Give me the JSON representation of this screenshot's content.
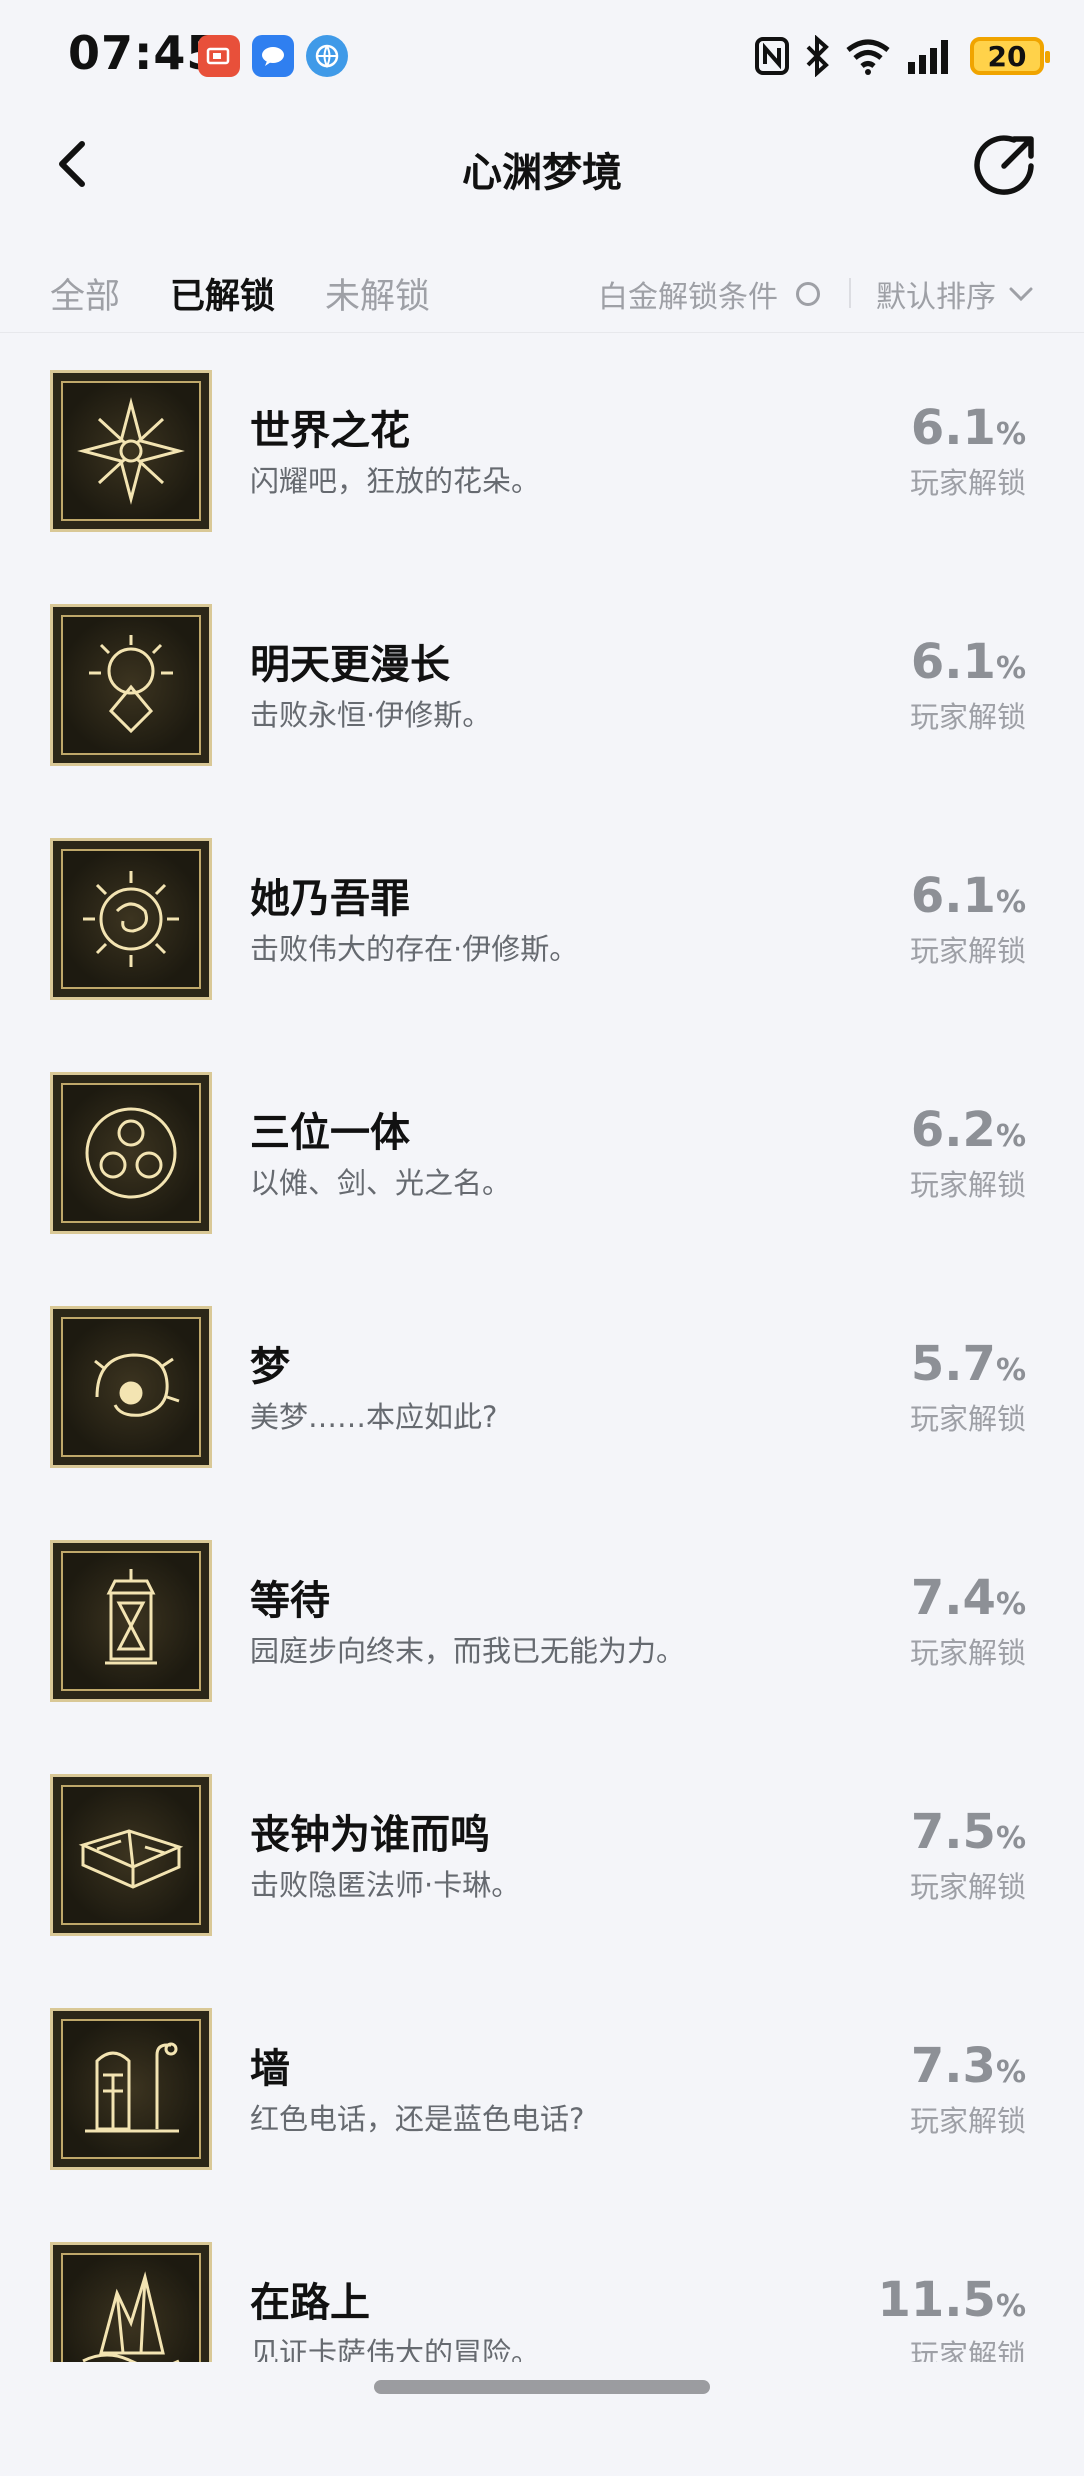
{
  "status_bar": {
    "time": "07:45",
    "battery": "20",
    "icons": [
      "app-red-icon",
      "chat-bubble-icon",
      "compass-icon",
      "nfc-icon",
      "bluetooth-icon",
      "wifi-icon",
      "signal-icon",
      "battery-icon"
    ]
  },
  "header": {
    "title": "心渊梦境",
    "back_icon": "chevron-left-icon",
    "share_icon": "share-icon"
  },
  "filters": {
    "tabs": [
      {
        "label": "全部",
        "active": false
      },
      {
        "label": "已解锁",
        "active": true
      },
      {
        "label": "未解锁",
        "active": false
      }
    ],
    "condition_label": "白金解锁条件",
    "sort_label": "默认排序"
  },
  "achievements": [
    {
      "title": "世界之花",
      "desc": "闪耀吧，狂放的花朵。",
      "pct": "6.1",
      "sign": "%",
      "label": "玩家解锁",
      "icon": "flower-icon"
    },
    {
      "title": "明天更漫长",
      "desc": "击败永恒·伊修斯。",
      "pct": "6.1",
      "sign": "%",
      "label": "玩家解锁",
      "icon": "crown-halo-icon"
    },
    {
      "title": "她乃吾罪",
      "desc": "击败伟大的存在·伊修斯。",
      "pct": "6.1",
      "sign": "%",
      "label": "玩家解锁",
      "icon": "sun-swirl-icon"
    },
    {
      "title": "三位一体",
      "desc": "以傩、剑、光之名。",
      "pct": "6.2",
      "sign": "%",
      "label": "玩家解锁",
      "icon": "triskelion-icon"
    },
    {
      "title": "梦",
      "desc": "美梦……本应如此?",
      "pct": "5.7",
      "sign": "%",
      "label": "玩家解锁",
      "icon": "dream-creature-icon"
    },
    {
      "title": "等待",
      "desc": "园庭步向终末，而我已无能为力。",
      "pct": "7.4",
      "sign": "%",
      "label": "玩家解锁",
      "icon": "lantern-hourglass-icon"
    },
    {
      "title": "丧钟为谁而鸣",
      "desc": "击败隐匿法师·卡琳。",
      "pct": "7.5",
      "sign": "%",
      "label": "玩家解锁",
      "icon": "open-book-icon"
    },
    {
      "title": "墙",
      "desc": "红色电话，还是蓝色电话?",
      "pct": "7.3",
      "sign": "%",
      "label": "玩家解锁",
      "icon": "phone-booth-icon"
    },
    {
      "title": "在路上",
      "desc": "见证卡萨伟大的冒险。",
      "pct": "11.5",
      "sign": "%",
      "label": "玩家解锁",
      "icon": "crystal-mountain-icon"
    }
  ]
}
